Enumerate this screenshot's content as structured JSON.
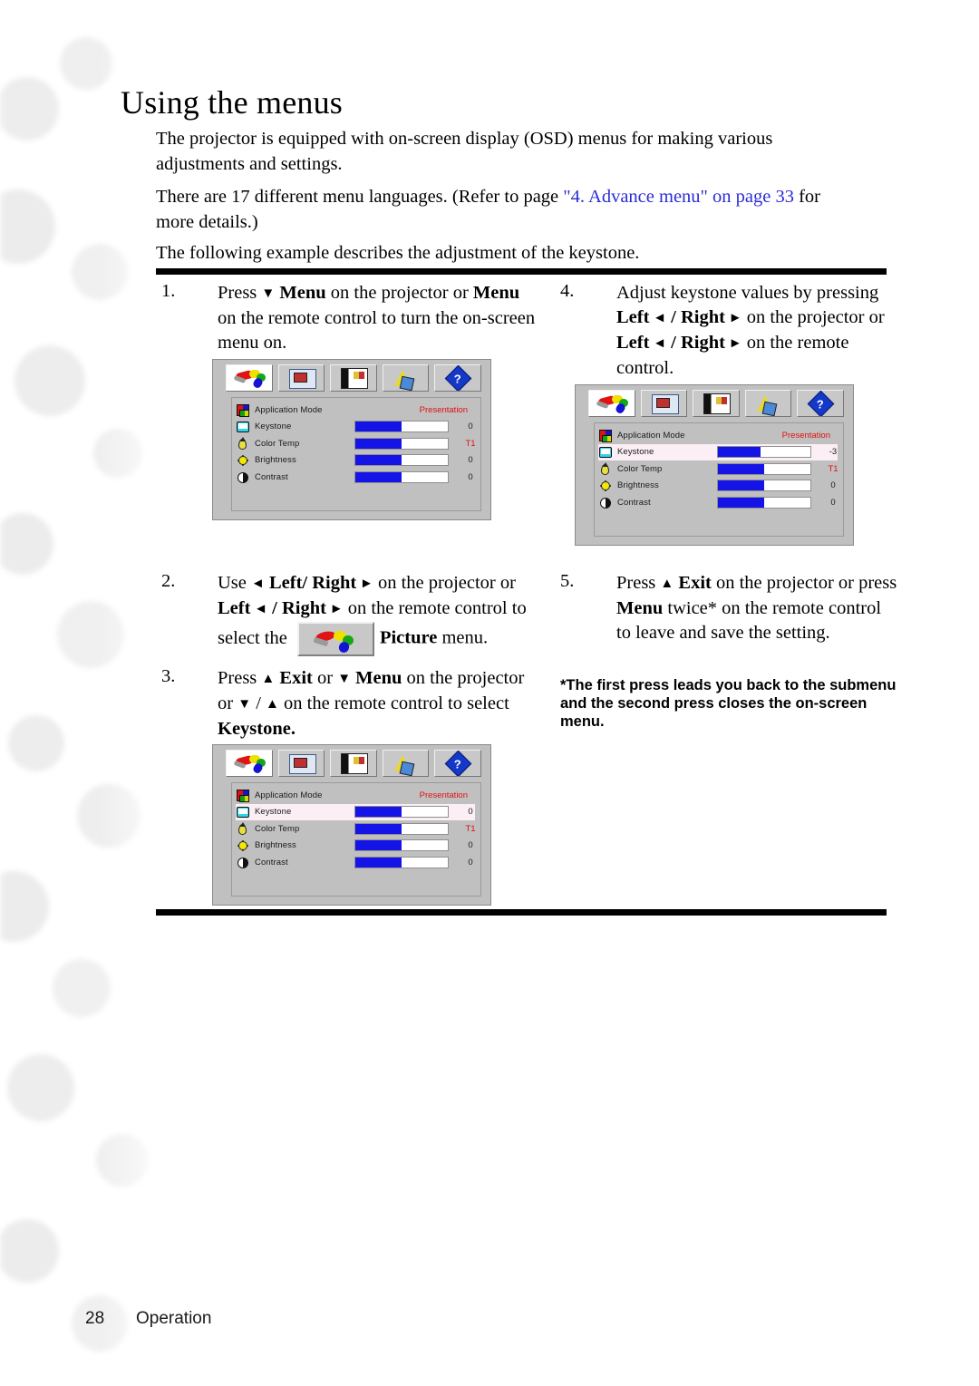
{
  "page": {
    "title": "Using the menus",
    "footer_page_number": "28",
    "footer_section": "Operation"
  },
  "intro": {
    "paragraph_1": "The projector is equipped with on-screen display (OSD) menus for making various adjustments and settings.",
    "paragraph_2_before": "There are 17 different menu languages. (Refer to page ",
    "paragraph_2_link": "\"4. Advance menu\" on page 33",
    "paragraph_2_after": " for more details.)",
    "paragraph_3": "The following example describes the adjustment of the keystone.",
    "link_color": "#2b2bd6"
  },
  "steps": [
    {
      "number": "1.",
      "text_parts": [
        {
          "t": "Press ",
          "style": "normal"
        },
        {
          "t": "▼",
          "style": "arrow"
        },
        {
          "t": " Menu",
          "style": "bold"
        },
        {
          "t": " on the projector or ",
          "style": "normal"
        },
        {
          "t": "Menu",
          "style": "bold"
        },
        {
          "t": " on the remote control to turn the on-screen menu on.",
          "style": "normal"
        }
      ]
    },
    {
      "number": "2.",
      "text_parts": [
        {
          "t": "Use ",
          "style": "normal"
        },
        {
          "t": "◄",
          "style": "arrow"
        },
        {
          "t": " Left/ Right",
          "style": "bold"
        },
        {
          "t": " ►",
          "style": "arrow"
        },
        {
          "t": " on the projector or ",
          "style": "normal"
        },
        {
          "t": "Left",
          "style": "bold"
        },
        {
          "t": " ◄",
          "style": "arrow"
        },
        {
          "t": " / Right",
          "style": "bold"
        },
        {
          "t": " ►",
          "style": "arrow"
        },
        {
          "t": " on the remote control to select the ",
          "style": "normal"
        }
      ],
      "after_icon_parts": [
        {
          "t": "Picture",
          "style": "bold"
        },
        {
          "t": " menu.",
          "style": "normal"
        }
      ],
      "inline_icon": "picture-menu-icon"
    },
    {
      "number": "3.",
      "text_parts": [
        {
          "t": "Press ",
          "style": "normal"
        },
        {
          "t": "▲",
          "style": "arrow"
        },
        {
          "t": " Exit",
          "style": "bold"
        },
        {
          "t": " or ",
          "style": "normal"
        },
        {
          "t": "▼",
          "style": "arrow"
        },
        {
          "t": " Menu",
          "style": "bold"
        },
        {
          "t": " on the projector or ",
          "style": "normal"
        },
        {
          "t": "▼",
          "style": "arrow"
        },
        {
          "t": " / ",
          "style": "normal"
        },
        {
          "t": "▲",
          "style": "arrow"
        },
        {
          "t": " on the remote control to select ",
          "style": "normal"
        },
        {
          "t": "Keystone.",
          "style": "bold"
        }
      ]
    },
    {
      "number": "4.",
      "text_parts": [
        {
          "t": "Adjust keystone values by pressing ",
          "style": "normal"
        },
        {
          "t": "Left",
          "style": "bold"
        },
        {
          "t": " ◄",
          "style": "arrow"
        },
        {
          "t": " / Right",
          "style": "bold"
        },
        {
          "t": " ►",
          "style": "arrow"
        },
        {
          "t": " on the projector or ",
          "style": "normal"
        },
        {
          "t": "Left",
          "style": "bold"
        },
        {
          "t": " ◄",
          "style": "arrow"
        },
        {
          "t": " / Right",
          "style": "bold"
        },
        {
          "t": " ►",
          "style": "arrow"
        },
        {
          "t": " on the remote control.",
          "style": "normal"
        }
      ]
    },
    {
      "number": "5.",
      "text_parts": [
        {
          "t": "Press ",
          "style": "normal"
        },
        {
          "t": "▲",
          "style": "arrow"
        },
        {
          "t": " Exit",
          "style": "bold"
        },
        {
          "t": " on the projector or press ",
          "style": "normal"
        },
        {
          "t": "Menu",
          "style": "bold"
        },
        {
          "t": " twice* on the remote control to leave and save the setting.",
          "style": "normal"
        }
      ]
    }
  ],
  "note": "*The first press leads you back to the submenu and the second press closes the on-screen menu.",
  "osd_tabs": [
    {
      "name": "picture-tab",
      "active": true
    },
    {
      "name": "pro-tab",
      "active": false
    },
    {
      "name": "source-tab",
      "active": false
    },
    {
      "name": "advance-tab",
      "active": false
    },
    {
      "name": "help-tab",
      "active": false,
      "glyph": "?"
    }
  ],
  "osd_menus": [
    {
      "caption": "step-1-osd",
      "mode_row": {
        "icon": "application-mode-icon",
        "label": "Application Mode",
        "value": "Presentation"
      },
      "rows": [
        {
          "icon": "keystone-icon",
          "label": "Keystone",
          "value": "0",
          "fill_percent": 50,
          "value_color": "dark",
          "highlighted": false
        },
        {
          "icon": "color-temp-icon",
          "label": "Color Temp",
          "value": "T1",
          "fill_percent": 50,
          "value_color": "red",
          "highlighted": false
        },
        {
          "icon": "brightness-icon",
          "label": "Brightness",
          "value": "0",
          "fill_percent": 50,
          "value_color": "dark",
          "highlighted": false
        },
        {
          "icon": "contrast-icon",
          "label": "Contrast",
          "value": "0",
          "fill_percent": 50,
          "value_color": "dark",
          "highlighted": false
        }
      ]
    },
    {
      "caption": "step-4-osd",
      "mode_row": {
        "icon": "application-mode-icon",
        "label": "Application Mode",
        "value": "Presentation"
      },
      "rows": [
        {
          "icon": "keystone-icon",
          "label": "Keystone",
          "value": "-3",
          "fill_percent": 46,
          "value_color": "dark",
          "highlighted": true
        },
        {
          "icon": "color-temp-icon",
          "label": "Color Temp",
          "value": "T1",
          "fill_percent": 50,
          "value_color": "red",
          "highlighted": false
        },
        {
          "icon": "brightness-icon",
          "label": "Brightness",
          "value": "0",
          "fill_percent": 50,
          "value_color": "dark",
          "highlighted": false
        },
        {
          "icon": "contrast-icon",
          "label": "Contrast",
          "value": "0",
          "fill_percent": 50,
          "value_color": "dark",
          "highlighted": false
        }
      ]
    },
    {
      "caption": "step-3-osd",
      "mode_row": {
        "icon": "application-mode-icon",
        "label": "Application Mode",
        "value": "Presentation"
      },
      "rows": [
        {
          "icon": "keystone-icon",
          "label": "Keystone",
          "value": "0",
          "fill_percent": 50,
          "value_color": "dark",
          "highlighted": true
        },
        {
          "icon": "color-temp-icon",
          "label": "Color Temp",
          "value": "T1",
          "fill_percent": 50,
          "value_color": "red",
          "highlighted": false
        },
        {
          "icon": "brightness-icon",
          "label": "Brightness",
          "value": "0",
          "fill_percent": 50,
          "value_color": "dark",
          "highlighted": false
        },
        {
          "icon": "contrast-icon",
          "label": "Contrast",
          "value": "0",
          "fill_percent": 50,
          "value_color": "dark",
          "highlighted": false
        }
      ]
    }
  ],
  "colors": {
    "slider_fill": "#1414e6",
    "osd_value_red": "#e01010",
    "osd_background": "#c0c0c0",
    "highlight_row": "#fbeef4"
  }
}
